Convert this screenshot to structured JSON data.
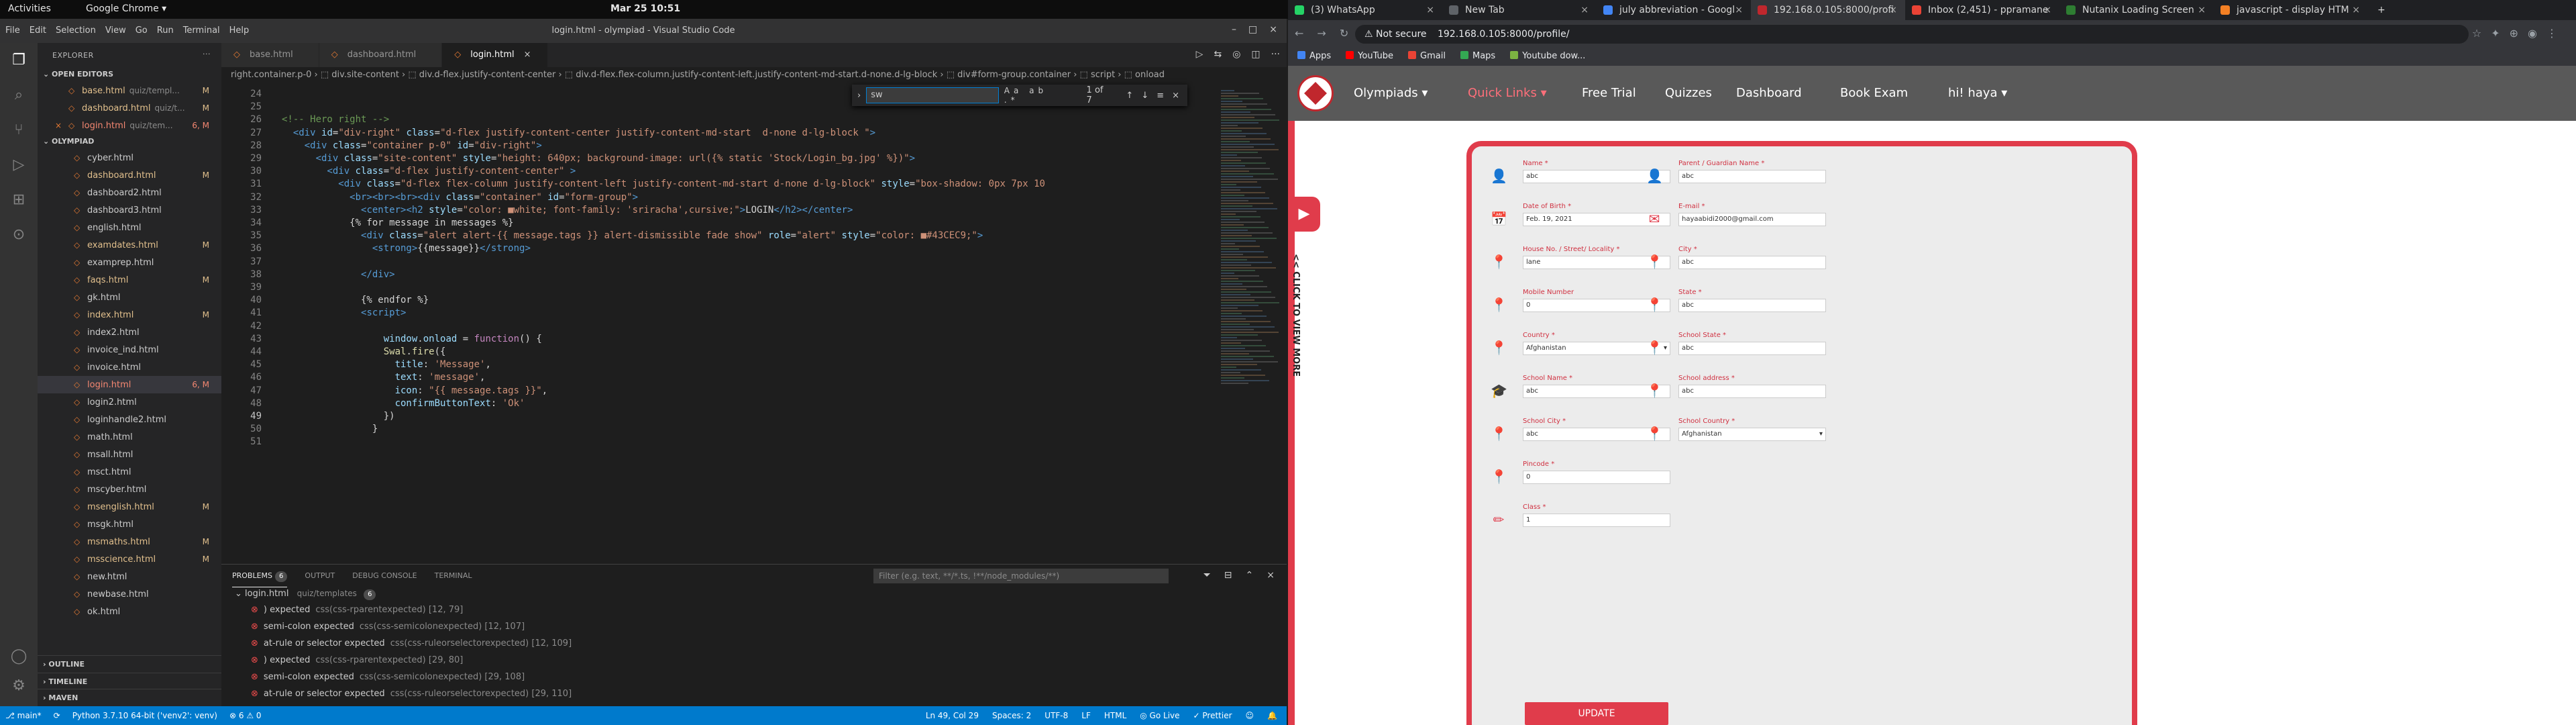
{
  "gnome": {
    "activities": "Activities",
    "app": "Google Chrome ▾",
    "clock": "Mar 25  10:51",
    "tray": "⚑ ◉ ♪ ⏻ ▾"
  },
  "vscode": {
    "menu": [
      "File",
      "Edit",
      "Selection",
      "View",
      "Go",
      "Run",
      "Terminal",
      "Help"
    ],
    "window_title": "login.html - olympiad - Visual Studio Code",
    "explorer": {
      "header": "EXPLORER",
      "open_editors": "OPEN EDITORS",
      "open_files": [
        {
          "name": "base.html",
          "path": "quiz/templ...",
          "status": "M",
          "cls": "mod"
        },
        {
          "name": "dashboard.html",
          "path": "quiz/t...",
          "status": "M",
          "cls": "mod"
        },
        {
          "name": "login.html",
          "path": "quiz/tem...",
          "status": "6, M",
          "cls": "err"
        }
      ],
      "project": "OLYMPIAD",
      "files": [
        {
          "name": "cyber.html",
          "status": "",
          "cls": ""
        },
        {
          "name": "dashboard.html",
          "status": "M",
          "cls": "mod"
        },
        {
          "name": "dashboard2.html",
          "status": "",
          "cls": ""
        },
        {
          "name": "dashboard3.html",
          "status": "",
          "cls": ""
        },
        {
          "name": "english.html",
          "status": "",
          "cls": ""
        },
        {
          "name": "examdates.html",
          "status": "M",
          "cls": "mod"
        },
        {
          "name": "examprep.html",
          "status": "",
          "cls": ""
        },
        {
          "name": "faqs.html",
          "status": "M",
          "cls": "mod"
        },
        {
          "name": "gk.html",
          "status": "",
          "cls": ""
        },
        {
          "name": "index.html",
          "status": "M",
          "cls": "mod"
        },
        {
          "name": "index2.html",
          "status": "",
          "cls": ""
        },
        {
          "name": "invoice_ind.html",
          "status": "",
          "cls": ""
        },
        {
          "name": "invoice.html",
          "status": "",
          "cls": ""
        },
        {
          "name": "login.html",
          "status": "6, M",
          "cls": "err sel"
        },
        {
          "name": "login2.html",
          "status": "",
          "cls": ""
        },
        {
          "name": "loginhandle2.html",
          "status": "",
          "cls": ""
        },
        {
          "name": "math.html",
          "status": "",
          "cls": ""
        },
        {
          "name": "msall.html",
          "status": "",
          "cls": ""
        },
        {
          "name": "msct.html",
          "status": "",
          "cls": ""
        },
        {
          "name": "mscyber.html",
          "status": "",
          "cls": ""
        },
        {
          "name": "msenglish.html",
          "status": "M",
          "cls": "mod"
        },
        {
          "name": "msgk.html",
          "status": "",
          "cls": ""
        },
        {
          "name": "msmaths.html",
          "status": "M",
          "cls": "mod"
        },
        {
          "name": "msscience.html",
          "status": "M",
          "cls": "mod"
        },
        {
          "name": "new.html",
          "status": "",
          "cls": ""
        },
        {
          "name": "newbase.html",
          "status": "",
          "cls": ""
        },
        {
          "name": "ok.html",
          "status": "",
          "cls": ""
        }
      ],
      "outline": "OUTLINE",
      "timeline": "TIMELINE",
      "maven": "MAVEN"
    },
    "tabs": [
      {
        "label": "base.html",
        "close": ""
      },
      {
        "label": "dashboard.html",
        "close": ""
      },
      {
        "label": "login.html",
        "close": "×"
      }
    ],
    "breadcrumb": "right.container.p-0 › ⬚ div.site-content › ⬚ div.d-flex.justify-content-center › ⬚ div.d-flex.flex-column.justify-content-left.justify-content-md-start.d-none.d-lg-block › ⬚ div#form-group.container › ⬚ script › ⬚ onload",
    "find": {
      "value": "sw",
      "options": "Aa ab .*",
      "count": "1 of 7",
      "nav": "↑↓≡×"
    },
    "code_lines": [
      {
        "n": "24",
        "html": ""
      },
      {
        "n": "25",
        "html": ""
      },
      {
        "n": "26",
        "html": "<span class='cm'>&lt;!-- Hero right --&gt;</span>"
      },
      {
        "n": "27",
        "html": "  <span class='tg'>&lt;div</span> <span class='at'>id</span>=<span class='sv'>\"div-right\"</span> <span class='at'>class</span>=<span class='sv'>\"d-flex justify-content-center justify-content-md-start  d-none d-lg-block \"</span><span class='tg'>&gt;</span>"
      },
      {
        "n": "28",
        "html": "    <span class='tg'>&lt;div</span> <span class='at'>class</span>=<span class='sv'>\"container p-0\"</span> <span class='at'>id</span>=<span class='sv'>\"div-right\"</span><span class='tg'>&gt;</span>"
      },
      {
        "n": "29",
        "html": "      <span class='tg'>&lt;div</span> <span class='at'>class</span>=<span class='sv'>\"site-content\"</span> <span class='at'>style</span>=<span class='sv'>\"height: 640px; background-image: url({% static 'Stock/Login_bg.jpg' %})\"</span><span class='tg'>&gt;</span>"
      },
      {
        "n": "30",
        "html": "        <span class='tg'>&lt;div</span> <span class='at'>class</span>=<span class='sv'>\"d-flex justify-content-center\"</span> <span class='tg'>&gt;</span>"
      },
      {
        "n": "31",
        "html": "          <span class='tg'>&lt;div</span> <span class='at'>class</span>=<span class='sv'>\"d-flex flex-column justify-content-left justify-content-md-start d-none d-lg-block\"</span> <span class='at'>style</span>=<span class='sv'>\"box-shadow: 0px 7px 10</span>"
      },
      {
        "n": "32",
        "html": "            <span class='tg'>&lt;br&gt;&lt;br&gt;&lt;br&gt;&lt;div</span> <span class='at'>class</span>=<span class='sv'>\"container\"</span> <span class='at'>id</span>=<span class='sv'>\"form-group\"</span><span class='tg'>&gt;</span>"
      },
      {
        "n": "33",
        "html": "              <span class='tg'>&lt;center&gt;&lt;h2</span> <span class='at'>style</span>=<span class='sv'>\"color: ■white; font-family: 'sriracha',cursive;\"</span><span class='tg'>&gt;</span>LOGIN<span class='tg'>&lt;/h2&gt;&lt;/center&gt;</span>"
      },
      {
        "n": "34",
        "html": "            {% for message in messages %}"
      },
      {
        "n": "35",
        "html": "              <span class='tg'>&lt;div</span> <span class='at'>class</span>=<span class='sv'>\"alert alert-{{ message.tags }} alert-dismissible fade show\"</span> <span class='at'>role</span>=<span class='sv'>\"alert\"</span> <span class='at'>style</span>=<span class='sv'>\"color: ■#43CEC9;\"</span><span class='tg'>&gt;</span>"
      },
      {
        "n": "36",
        "html": "                <span class='tg'>&lt;strong&gt;</span>{{message}}<span class='tg'>&lt;/strong&gt;</span>"
      },
      {
        "n": "37",
        "html": ""
      },
      {
        "n": "38",
        "html": "              <span class='tg'>&lt;/div&gt;</span>"
      },
      {
        "n": "39",
        "html": ""
      },
      {
        "n": "40",
        "html": "              {% endfor %}"
      },
      {
        "n": "41",
        "html": "              <span class='tg'>&lt;script&gt;</span>"
      },
      {
        "n": "42",
        "html": ""
      },
      {
        "n": "43",
        "html": "                  <span class='at'>window</span>.<span class='at'>onload</span> = <span class='kw'>function</span>() {"
      },
      {
        "n": "44",
        "html": "                  <span class='fn'>Swal</span>.<span class='fn'>fire</span>({"
      },
      {
        "n": "45",
        "html": "                    <span class='at'>title</span>: <span class='sv'>'Message'</span>,"
      },
      {
        "n": "46",
        "html": "                    <span class='at'>text</span>: <span class='sv'>'message'</span>,"
      },
      {
        "n": "47",
        "html": "                    <span class='at'>icon</span>: <span class='sv'>\"{{ message.tags }}\"</span>,"
      },
      {
        "n": "48",
        "html": "                    <span class='at'>confirmButtonText</span>: <span class='sv'>'Ok'</span>"
      },
      {
        "n": "49",
        "html": "                  })"
      },
      {
        "n": "50",
        "html": "                }"
      },
      {
        "n": "51",
        "html": ""
      }
    ],
    "panel": {
      "tabs": [
        {
          "label": "PROBLEMS",
          "badge": "6"
        },
        {
          "label": "OUTPUT",
          "badge": ""
        },
        {
          "label": "DEBUG CONSOLE",
          "badge": ""
        },
        {
          "label": "TERMINAL",
          "badge": ""
        }
      ],
      "filter_placeholder": "Filter (e.g. text, **/*.ts, !**/node_modules/**)",
      "file": "login.html",
      "file_path": "quiz/templates",
      "file_count": "6",
      "problems": [
        {
          "msg": ") expected",
          "src": "css(css-rparentexpected)  [12, 79]"
        },
        {
          "msg": "semi-colon expected",
          "src": "css(css-semicolonexpected)  [12, 107]"
        },
        {
          "msg": "at-rule or selector expected",
          "src": "css(css-ruleorselectorexpected)  [12, 109]"
        },
        {
          "msg": ") expected",
          "src": "css(css-rparentexpected)  [29, 80]"
        },
        {
          "msg": "semi-colon expected",
          "src": "css(css-semicolonexpected)  [29, 108]"
        },
        {
          "msg": "at-rule or selector expected",
          "src": "css(css-ruleorselectorexpected)  [29, 110]"
        }
      ]
    },
    "status": {
      "branch": "⎇ main*",
      "sync": "⟳",
      "python": "Python 3.7.10 64-bit ('venv2': venv)",
      "errors": "⊗ 6 ⚠ 0",
      "position": "Ln 49, Col 29",
      "spaces": "Spaces: 2",
      "encoding": "UTF-8",
      "eol": "LF",
      "lang": "HTML",
      "golive": "◎ Go Live",
      "prettier": "✓ Prettier"
    }
  },
  "chrome": {
    "tabs": [
      {
        "label": "(3) WhatsApp",
        "color": "#25d366"
      },
      {
        "label": "New Tab",
        "color": "#5f6368"
      },
      {
        "label": "july abbreviation - Googl",
        "color": "#4285f4"
      },
      {
        "label": "192.168.0.105:8000/profi",
        "color": "#c0272d"
      },
      {
        "label": "Inbox (2,451) - ppramane",
        "color": "#ea4335"
      },
      {
        "label": "Nutanix Loading Screen",
        "color": "#2e7d32"
      },
      {
        "label": "javascript - display HTM",
        "color": "#f48024"
      }
    ],
    "not_secure": "⚠ Not secure",
    "url": "192.168.0.105:8000/profile/",
    "bookmarks": [
      {
        "label": "Apps",
        "color": "#4285f4"
      },
      {
        "label": "YouTube",
        "color": "#ff0000"
      },
      {
        "label": "Gmail",
        "color": "#ea4335"
      },
      {
        "label": "Maps",
        "color": "#34a853"
      },
      {
        "label": "Youtube dow...",
        "color": "#7cb342"
      }
    ],
    "site_nav": [
      "Olympiads ▾",
      "Quick Links ▾",
      "Free Trial",
      "Quizzes",
      "Dashboard",
      "Book Exam",
      "hi! haya ▾"
    ],
    "side_text": "<< CLICK TO VIEW MORE",
    "fields": [
      {
        "label": "Name *",
        "value": "abc",
        "select": false
      },
      {
        "label": "Parent / Guardian Name *",
        "value": "abc",
        "select": false
      },
      {
        "label": "Date of Birth *",
        "value": "Feb. 19, 2021",
        "select": false
      },
      {
        "label": "E-mail *",
        "value": "hayaabidi2000@gmail.com",
        "select": false
      },
      {
        "label": "House No. / Street/ Locality *",
        "value": "lane",
        "select": false
      },
      {
        "label": "City *",
        "value": "abc",
        "select": false
      },
      {
        "label": "Mobile Number",
        "value": "0",
        "select": false
      },
      {
        "label": "State *",
        "value": "abc",
        "select": false
      },
      {
        "label": "Country *",
        "value": "Afghanistan",
        "select": true
      },
      {
        "label": "School State *",
        "value": "abc",
        "select": false
      },
      {
        "label": "School Name *",
        "value": "abc",
        "select": false
      },
      {
        "label": "School address *",
        "value": "abc",
        "select": false
      },
      {
        "label": "School City *",
        "value": "abc",
        "select": false
      },
      {
        "label": "School Country *",
        "value": "Afghanistan",
        "select": true
      },
      {
        "label": "Pincode *",
        "value": "0",
        "select": false
      },
      {
        "label": "Class *",
        "value": "1",
        "select": false
      }
    ],
    "update_label": "UPDATE"
  }
}
